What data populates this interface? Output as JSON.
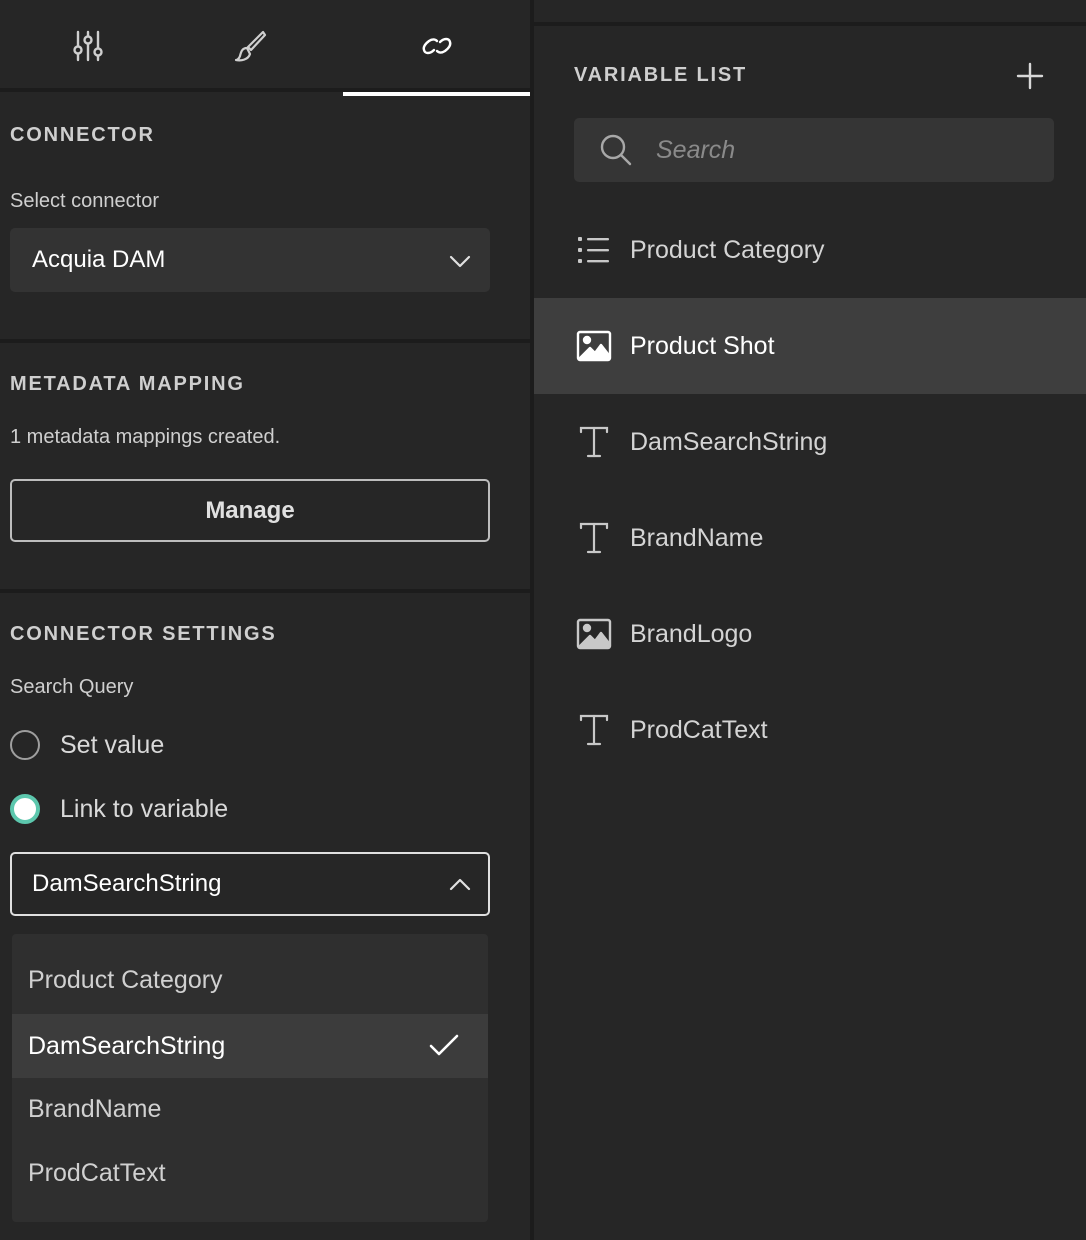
{
  "tabs": [
    {
      "name": "properties",
      "icon": "sliders-icon",
      "active": false
    },
    {
      "name": "style",
      "icon": "brush-icon",
      "active": false
    },
    {
      "name": "link",
      "icon": "link-icon",
      "active": true
    }
  ],
  "connector": {
    "title": "CONNECTOR",
    "select_label": "Select connector",
    "selected": "Acquia DAM"
  },
  "metadata": {
    "title": "METADATA MAPPING",
    "status": "1 metadata mappings created.",
    "manage_label": "Manage"
  },
  "settings": {
    "title": "CONNECTOR SETTINGS",
    "query_label": "Search Query",
    "option_set_value": "Set value",
    "option_link_variable": "Link to variable",
    "selected_option": "Link to variable",
    "variable_selected": "DamSearchString",
    "dropdown_items": [
      "Product Category",
      "DamSearchString",
      "BrandName",
      "ProdCatText"
    ],
    "dropdown_selected": "DamSearchString"
  },
  "variables": {
    "title": "VARIABLE LIST",
    "search_placeholder": "Search",
    "items": [
      {
        "label": "Product Category",
        "icon": "list-icon"
      },
      {
        "label": "Product Shot",
        "icon": "image-icon",
        "active": true
      },
      {
        "label": "DamSearchString",
        "icon": "text-icon"
      },
      {
        "label": "BrandName",
        "icon": "text-icon"
      },
      {
        "label": "BrandLogo",
        "icon": "image-icon"
      },
      {
        "label": "ProdCatText",
        "icon": "text-icon"
      }
    ]
  },
  "colors": {
    "background": "#262626",
    "accent_radio": "#5cc7ad",
    "active_row": "#3e3e3e"
  }
}
